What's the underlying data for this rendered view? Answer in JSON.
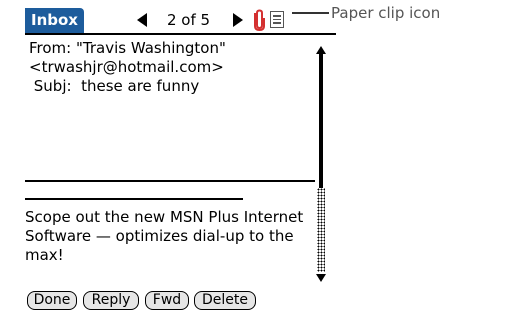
{
  "titlebar": {
    "tab_label": "Inbox",
    "counter": "2 of 5"
  },
  "message": {
    "header_lines": [
      "From: \"Travis Washington\"",
      "<trwashjr@hotmail.com>",
      " Subj:  these are funny"
    ],
    "body_lines": [
      "Scope out the new MSN Plus Internet",
      "Software — optimizes dial-up to the",
      "max!"
    ]
  },
  "buttons": {
    "done": "Done",
    "reply": "Reply",
    "fwd": "Fwd",
    "delete": "Delete"
  },
  "callout": {
    "text": "Paper clip icon"
  },
  "icons": {
    "attachment": "paper-clip-icon",
    "menu": "menu-icon",
    "prev": "left-arrow-icon",
    "next": "right-arrow-icon",
    "accent": "#d43030",
    "tab_color": "#1d5c9c"
  }
}
